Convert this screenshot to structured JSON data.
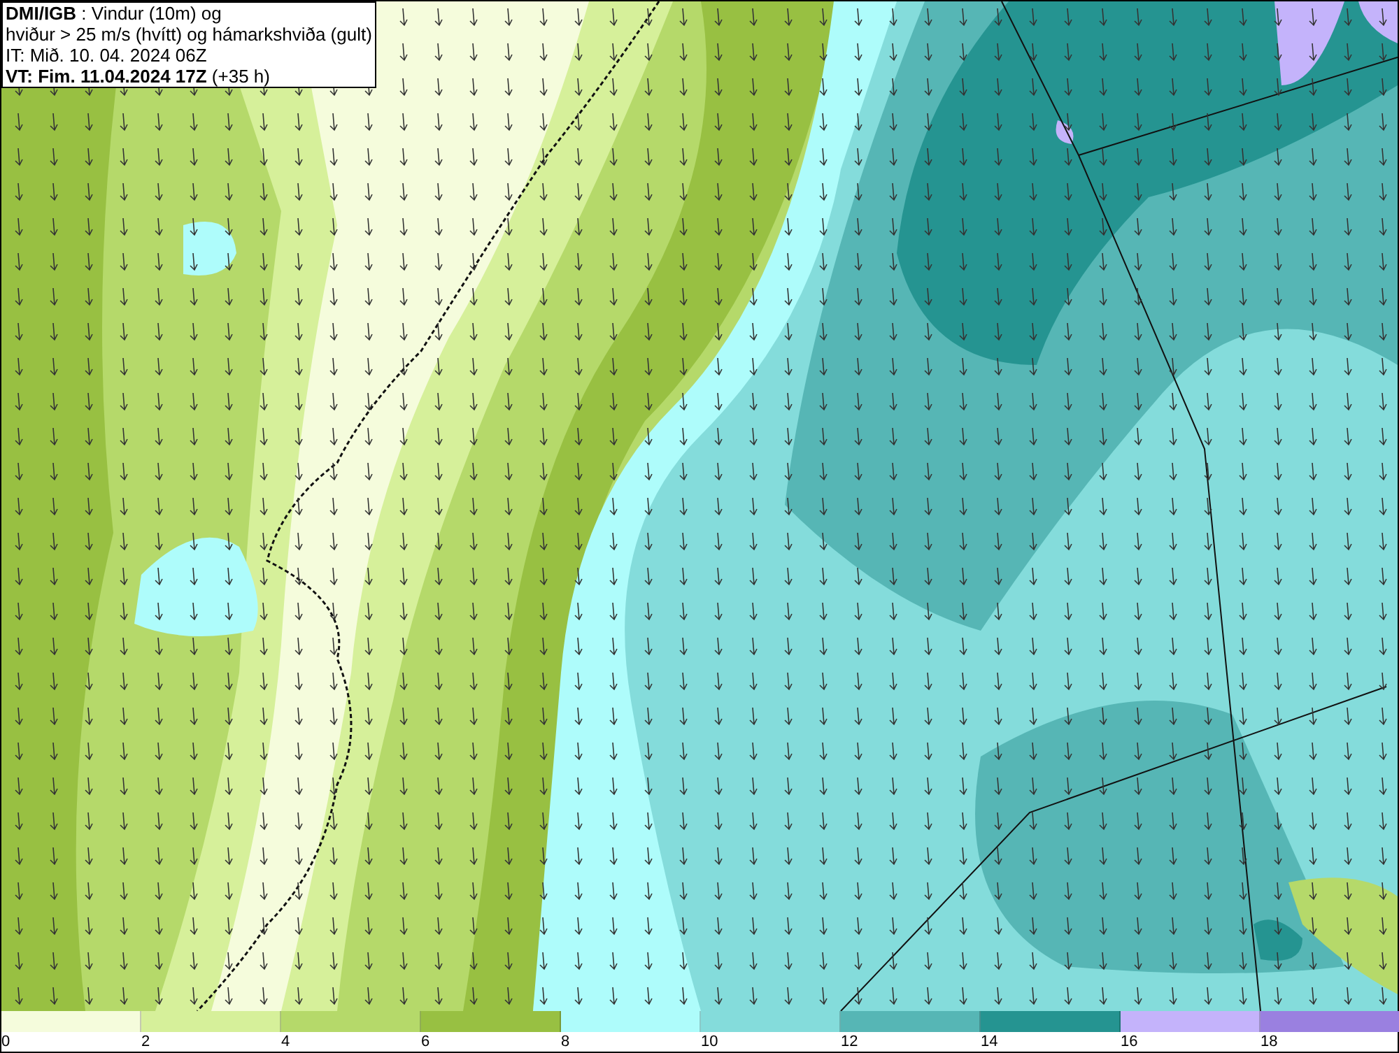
{
  "title_box": {
    "lines": [
      "**DMI/IGB** : Vindur (10m) og",
      "hviður > 25 m/s (hvítt) og hámarkshviða (gult)",
      "IT: Mið. 10. 04. 2024 06Z",
      "**VT: Fim. 11.04.2024 17Z** (+35 h)"
    ]
  },
  "legend": {
    "segments": [
      {
        "color": "#f5fcdc"
      },
      {
        "color": "#d6f09a"
      },
      {
        "color": "#b5d96a"
      },
      {
        "color": "#98c042"
      },
      {
        "color": "#aefcfb"
      },
      {
        "color": "#84dcdb"
      },
      {
        "color": "#56b6b5"
      },
      {
        "color": "#259491"
      },
      {
        "color": "#c4b3fb"
      },
      {
        "color": "#9a80e0"
      }
    ],
    "ticks": [
      "0",
      "2",
      "4",
      "6",
      "8",
      "10",
      "12",
      "14",
      "16",
      "18"
    ]
  }
}
